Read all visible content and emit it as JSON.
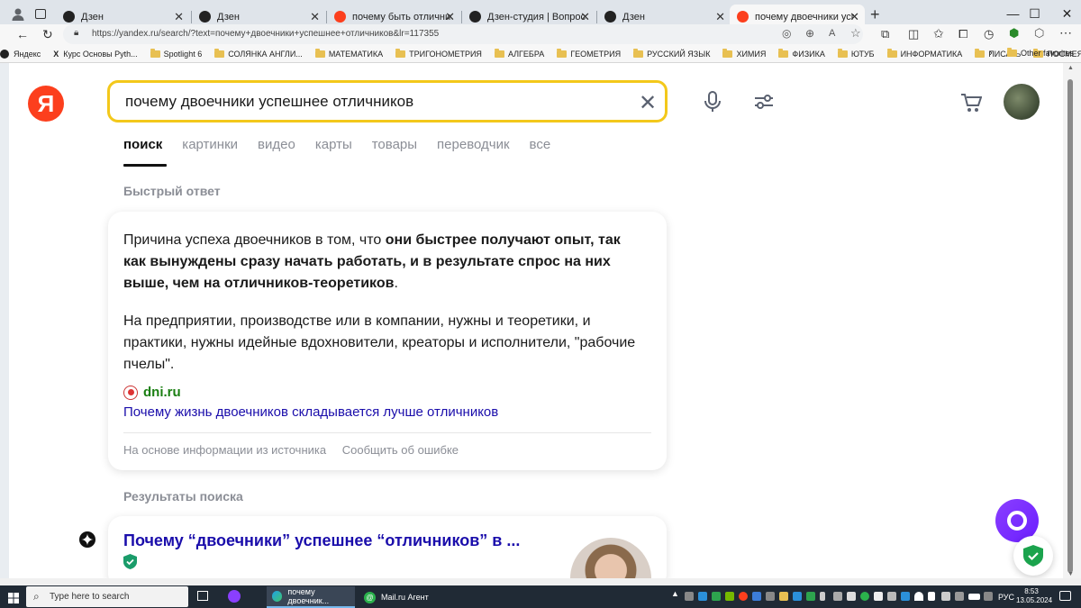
{
  "browser": {
    "tabs": [
      {
        "label": "Дзен",
        "favicon": "zen-icon",
        "active": false
      },
      {
        "label": "Дзен",
        "favicon": "zen-icon",
        "active": false
      },
      {
        "label": "почему быть отличником лучш",
        "favicon": "yandex-icon",
        "active": false
      },
      {
        "label": "Дзен-студия | Вопрос, на котор",
        "favicon": "zen-icon",
        "active": false
      },
      {
        "label": "Дзен",
        "favicon": "zen-icon",
        "active": false
      },
      {
        "label": "почему двоечники успешнее о",
        "favicon": "yandex-icon",
        "active": true
      }
    ],
    "new_tab": "+",
    "window_controls": {
      "minimize": "—",
      "maximize": "☐",
      "close": "✕"
    },
    "url": "https://yandex.ru/search/?text=почему+двоечники+успешнее+отличников&lr=117355",
    "bookmarks": [
      {
        "label": "Яндекс",
        "icon": "yandex-icon"
      },
      {
        "label": "Курс Основы Pyth...",
        "icon": "x-icon"
      },
      {
        "label": "Spotlight 6",
        "icon": "folder-icon"
      },
      {
        "label": "СОЛЯНКА АНГЛИ...",
        "icon": "folder-icon"
      },
      {
        "label": "МАТЕМАТИКА",
        "icon": "folder-icon"
      },
      {
        "label": "ТРИГОНОМЕТРИЯ",
        "icon": "folder-icon"
      },
      {
        "label": "АЛГЕБРА",
        "icon": "folder-icon"
      },
      {
        "label": "ГЕОМЕТРИЯ",
        "icon": "folder-icon"
      },
      {
        "label": "РУССКИЙ ЯЗЫК",
        "icon": "folder-icon"
      },
      {
        "label": "ХИМИЯ",
        "icon": "folder-icon"
      },
      {
        "label": "ФИЗИКА",
        "icon": "folder-icon"
      },
      {
        "label": "ЮТУБ",
        "icon": "folder-icon"
      },
      {
        "label": "ИНФОРМАТИКА",
        "icon": "folder-icon"
      },
      {
        "label": "ПИСАТЬ",
        "icon": "folder-icon"
      },
      {
        "label": "ПОСМЕЯТЬСЯ",
        "icon": "folder-icon"
      }
    ],
    "other_favorites": "Other favorites"
  },
  "page": {
    "logo": "Я",
    "search_query": "почему двоечники успешнее отличников",
    "nav": [
      "поиск",
      "картинки",
      "видео",
      "карты",
      "товары",
      "переводчик",
      "все"
    ],
    "quick_answer_label": "Быстрый ответ",
    "answer": {
      "p1_start": "Причина успеха двоечников в том, что ",
      "p1_bold": "они быстрее получают опыт, так как вынуждены сразу начать работать, и в результате спрос на них выше, чем на отличников-теоретиков",
      "p1_end": ".",
      "p2": "На предприятии, производстве или в компании, нужны и теоретики, и практики, нужны идейные вдохновители, креаторы и исполнители, \"рабочие пчелы\".",
      "source_domain": "dni.ru",
      "source_link": "Почему жизнь двоечников складывается лучше отличников",
      "footer_based": "На основе информации из источника",
      "footer_report": "Сообщить об ошибке"
    },
    "results_label": "Результаты поиска",
    "result1_title": "Почему “двоечники” успешнее “отличников” в ..."
  },
  "taskbar": {
    "search_placeholder": "Type here to search",
    "apps": [
      {
        "label": "почему двоечник...",
        "icon": "edge-icon"
      },
      {
        "label": "Mail.ru Агент",
        "icon": "mailru-agent-icon"
      }
    ],
    "language": "РУС",
    "time": "8:53",
    "date": "13.05.2024"
  },
  "colors": {
    "yandex_red": "#fc3f1d",
    "search_border": "#f3c81b",
    "link": "#1a0dab",
    "source_green": "#1a7f12",
    "alice_purple": "#7b2cff"
  }
}
